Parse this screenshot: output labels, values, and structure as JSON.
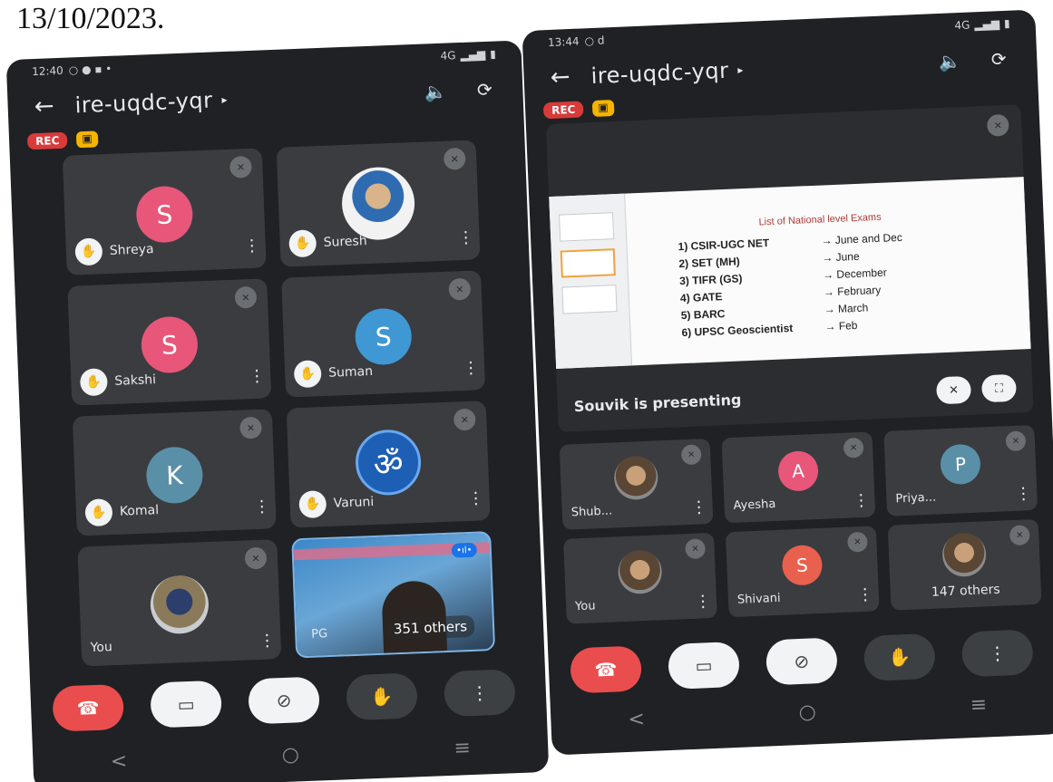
{
  "caption": "13/10/2023.",
  "left": {
    "status": {
      "time": "12:40",
      "network": "4G"
    },
    "meeting_code": "ire-uqdc-yqr",
    "rec_label": "REC",
    "tiles": [
      {
        "name": "Shreya",
        "initial": "S",
        "color": "#e8567a"
      },
      {
        "name": "Suresh",
        "photo": true
      },
      {
        "name": "Sakshi",
        "initial": "S",
        "color": "#e8567a"
      },
      {
        "name": "Suman",
        "initial": "S",
        "color": "#3f98d3"
      },
      {
        "name": "Komal",
        "initial": "K",
        "color": "#5a8fa8"
      },
      {
        "name": "Varuni",
        "om": true
      }
    ],
    "you_label": "You",
    "share_tile": {
      "short_label": "PG",
      "others": "351 others"
    }
  },
  "right": {
    "status": {
      "time": "13:44",
      "network": "4G"
    },
    "meeting_code": "ire-uqdc-yqr",
    "rec_label": "REC",
    "slide": {
      "title": "List of National level Exams",
      "items": [
        {
          "exam": "1) CSIR-UGC NET",
          "date": "→ June and Dec"
        },
        {
          "exam": "2) SET (MH)",
          "date": "→ June"
        },
        {
          "exam": "3) TIFR (GS)",
          "date": "→ December"
        },
        {
          "exam": "4) GATE",
          "date": "→ February"
        },
        {
          "exam": "5) BARC",
          "date": "→ March"
        },
        {
          "exam": "6) UPSC Geoscientist",
          "date": "→ Feb"
        }
      ]
    },
    "presenting_label": "Souvik is presenting",
    "tiles": [
      {
        "name": "Shub...",
        "photo": true
      },
      {
        "name": "Ayesha",
        "initial": "A",
        "color": "#e8567a"
      },
      {
        "name": "Priya...",
        "initial": "P",
        "color": "#5a8fa8"
      },
      {
        "name": "You",
        "photo": true
      },
      {
        "name": "Shivani",
        "initial": "S",
        "color": "#e9604e"
      },
      {
        "others": "147 others"
      }
    ]
  },
  "icons": {
    "back": "←",
    "speaker": "🔈",
    "flip_camera": "⟳",
    "more": "⋮",
    "hand": "✋",
    "mute": "✕",
    "end_call": "☎",
    "camera_off": "▭",
    "mic_off": "⊘",
    "nav_back": "<",
    "nav_home": "○",
    "nav_recents": "≡",
    "pin": "✕",
    "fullscreen": "⛶",
    "om": "ॐ"
  }
}
